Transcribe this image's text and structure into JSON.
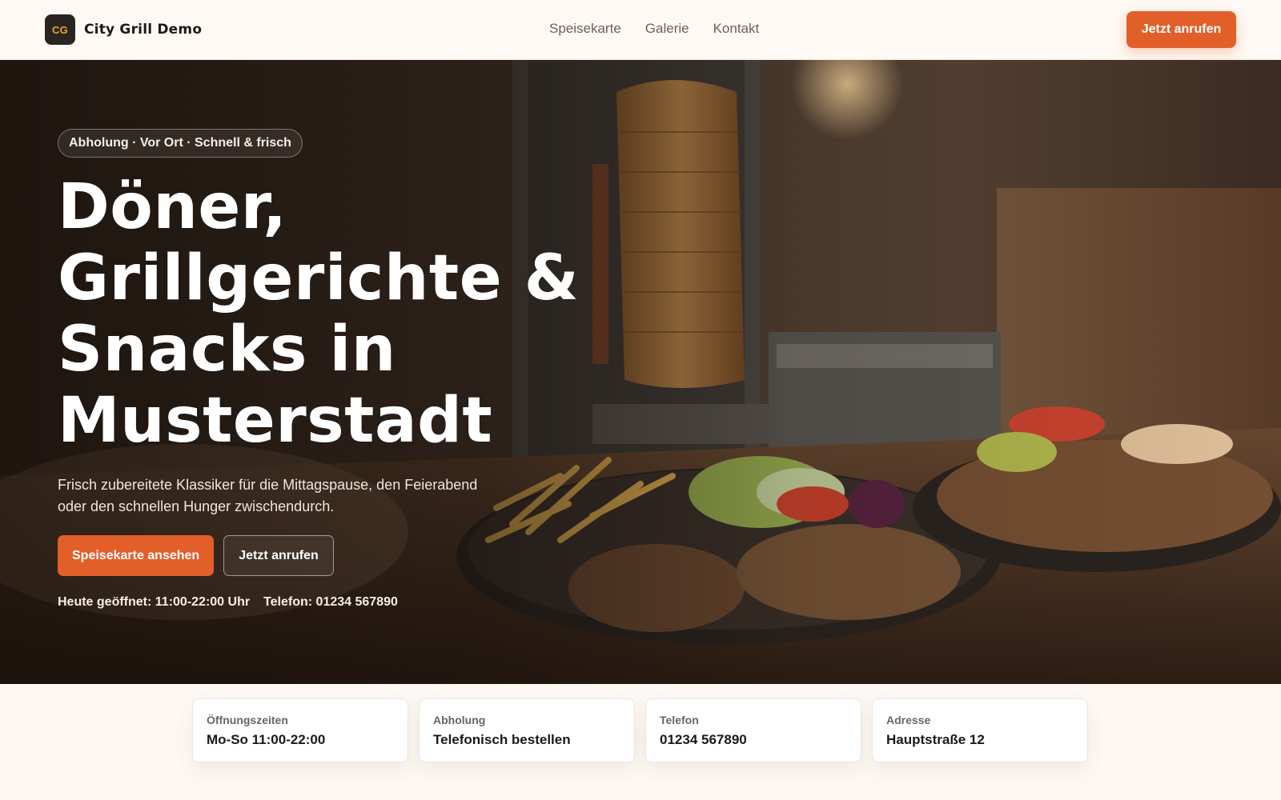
{
  "header": {
    "logo_text": "CG",
    "brand_name": "City Grill Demo",
    "nav": [
      "Speisekarte",
      "Galerie",
      "Kontakt"
    ],
    "cta_label": "Jetzt anrufen"
  },
  "hero": {
    "badge": "Abholung · Vor Ort · Schnell & frisch",
    "title": "Döner, Grillgerichte & Snacks in Musterstadt",
    "subtitle": "Frisch zubereitete Klassiker für die Mittagspause, den Feierabend oder den schnellen Hunger zwischendurch.",
    "primary_button": "Speisekarte ansehen",
    "secondary_button": "Jetzt anrufen",
    "hours_note": "Heute geöffnet: 11:00-22:00 Uhr",
    "phone_note": "Telefon: 01234 567890"
  },
  "info_cards": [
    {
      "label": "Öffnungszeiten",
      "value": "Mo-So 11:00-22:00"
    },
    {
      "label": "Abholung",
      "value": "Telefonisch bestellen"
    },
    {
      "label": "Telefon",
      "value": "01234 567890"
    },
    {
      "label": "Adresse",
      "value": "Hauptstraße 12"
    }
  ],
  "colors": {
    "accent": "#e35f2a",
    "logo_bg": "#2a2522",
    "logo_text": "#f0a431",
    "page_bg": "#fdf8f3"
  }
}
